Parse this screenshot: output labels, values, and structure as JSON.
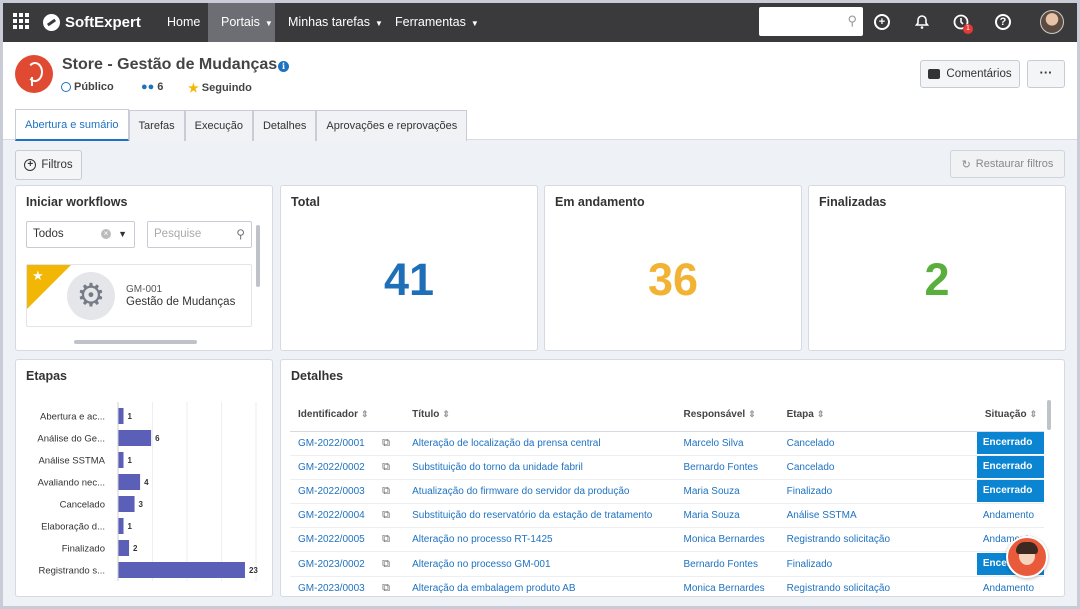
{
  "topbar": {
    "brand": "SoftExpert",
    "nav": {
      "home": "Home",
      "portais": "Portais",
      "tarefas": "Minhas tarefas",
      "ferramentas": "Ferramentas"
    },
    "notification_count": "1"
  },
  "header": {
    "title": "Store - Gestão de Mudanças",
    "visibility": "Público",
    "members": "6",
    "following": "Seguindo",
    "comments_label": "Comentários",
    "more_label": "···"
  },
  "tabs": [
    "Abertura e sumário",
    "Tarefas",
    "Execução",
    "Detalhes",
    "Aprovações e reprovações"
  ],
  "filters": {
    "filters_label": "Filtros",
    "restore_label": "Restaurar filtros"
  },
  "workflows": {
    "title": "Iniciar workflows",
    "select_value": "Todos",
    "search_placeholder": "Pesquise",
    "item": {
      "code": "GM-001",
      "name": "Gestão de Mudanças"
    }
  },
  "stats": {
    "total": {
      "label": "Total",
      "value": "41",
      "color": "#1f6fb8"
    },
    "in_progress": {
      "label": "Em andamento",
      "value": "36",
      "color": "#f2b233"
    },
    "finished": {
      "label": "Finalizadas",
      "value": "2",
      "color": "#5aae3c"
    }
  },
  "steps": {
    "title": "Etapas"
  },
  "chart_data": {
    "type": "bar",
    "orientation": "horizontal",
    "bar_color": "#5c5fb7",
    "categories": [
      "Abertura e ac...",
      "Análise do Ge...",
      "Análise SSTMA",
      "Avaliando nec...",
      "Cancelado",
      "Elaboração d...",
      "Finalizado",
      "Registrando s..."
    ],
    "values": [
      1,
      6,
      1,
      4,
      3,
      1,
      2,
      23
    ],
    "xlim": [
      0,
      25
    ]
  },
  "details": {
    "title": "Detalhes",
    "columns": [
      "Identificador",
      "Título",
      "Responsável",
      "Etapa",
      "Situação"
    ],
    "rows": [
      {
        "id": "GM-2022/0001",
        "title": "Alteração de localização da prensa central",
        "owner": "Marcelo Silva",
        "step": "Cancelado",
        "status": "Encerrado",
        "solid": true
      },
      {
        "id": "GM-2022/0002",
        "title": "Substituição do torno da unidade fabril",
        "owner": "Bernardo Fontes",
        "step": "Cancelado",
        "status": "Encerrado",
        "solid": true
      },
      {
        "id": "GM-2022/0003",
        "title": "Atualização do firmware do servidor da produção",
        "owner": "Maria Souza",
        "step": "Finalizado",
        "status": "Encerrado",
        "solid": true
      },
      {
        "id": "GM-2022/0004",
        "title": "Substituição do reservatório da estação de tratamento",
        "owner": "Maria Souza",
        "step": "Análise SSTMA",
        "status": "Andamento",
        "solid": false
      },
      {
        "id": "GM-2022/0005",
        "title": "Alteração no processo RT-1425",
        "owner": "Monica Bernardes",
        "step": "Registrando solicitação",
        "status": "Andamento",
        "solid": false
      },
      {
        "id": "GM-2023/0002",
        "title": "Alteração no processo GM-001",
        "owner": "Bernardo Fontes",
        "step": "Finalizado",
        "status": "Encerrado",
        "solid": true
      },
      {
        "id": "GM-2023/0003",
        "title": "Alteração da embalagem produto AB",
        "owner": "Monica Bernardes",
        "step": "Registrando solicitação",
        "status": "Andamento",
        "solid": false
      }
    ]
  }
}
